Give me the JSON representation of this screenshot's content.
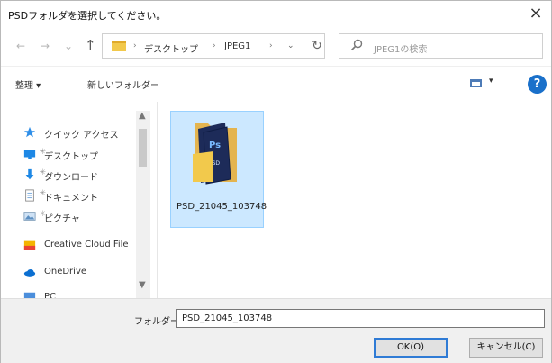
{
  "dialog": {
    "title": "PSDフォルダを選択してください。",
    "close_glyph": "×"
  },
  "nav": {
    "back_glyph": "←",
    "forward_glyph": "→",
    "recent_glyph": "⌄",
    "up_glyph": "↑",
    "path": [
      "デスクトップ",
      "JPEG1"
    ],
    "path_separator": "›",
    "dropdown_glyph": "⌄",
    "refresh_glyph": "↻",
    "search_placeholder": "JPEG1の検索"
  },
  "toolbar": {
    "organize_label": "整理 ▾",
    "new_folder_label": "新しいフォルダー",
    "view_dropdown_glyph": "▾",
    "help_glyph": "?"
  },
  "sidebar": {
    "items": [
      {
        "label": "クイック アクセス",
        "icon": "star-icon"
      },
      {
        "label": "デスクトップ",
        "icon": "desktop-icon",
        "pinned": "✳"
      },
      {
        "label": "ダウンロード",
        "icon": "download-icon",
        "pinned": "✳"
      },
      {
        "label": "ドキュメント",
        "icon": "document-icon",
        "pinned": "✳"
      },
      {
        "label": "ピクチャ",
        "icon": "pictures-icon",
        "pinned": "✳"
      },
      {
        "label": "Creative Cloud File",
        "icon": "creative-cloud-icon"
      },
      {
        "label": "OneDrive",
        "icon": "onedrive-icon"
      },
      {
        "label": "PC",
        "icon": "pc-icon"
      }
    ],
    "scroll_up_glyph": "▲",
    "scroll_down_glyph": "▼"
  },
  "files": [
    {
      "name": "PSD_21045_103748"
    }
  ],
  "bottom": {
    "folder_label": "フォルダー:",
    "folder_value": "PSD_21045_103748",
    "ok_label": "OK(O)",
    "cancel_label": "キャンセル(C)"
  },
  "colors": {
    "selection": "#cce8ff",
    "accent": "#1a70ca",
    "folder": "#f2c94c"
  }
}
